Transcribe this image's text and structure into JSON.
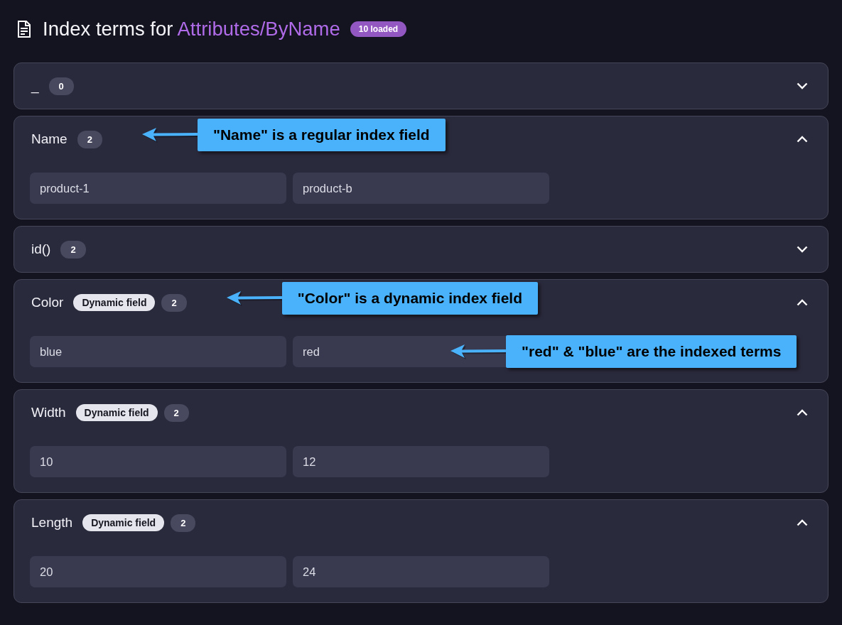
{
  "header": {
    "title_prefix": "Index terms for",
    "index_name": "Attributes/ByName",
    "loaded_badge": "10 loaded"
  },
  "fields": [
    {
      "name": "_",
      "count": "0",
      "expanded": false
    },
    {
      "name": "Name",
      "count": "2",
      "header_callout": "\"Name\" is a regular index field",
      "expanded": true,
      "terms": [
        "product-1",
        "product-b"
      ]
    },
    {
      "name": "id()",
      "count": "2",
      "expanded": false
    },
    {
      "name": "Color",
      "tag": "Dynamic field",
      "count": "2",
      "header_callout": "\"Color\" is a dynamic index field",
      "expanded": true,
      "terms": [
        "blue",
        "red"
      ],
      "terms_callout": "\"red\" & \"blue\" are the indexed terms"
    },
    {
      "name": "Width",
      "tag": "Dynamic field",
      "count": "2",
      "expanded": true,
      "terms": [
        "10",
        "12"
      ]
    },
    {
      "name": "Length",
      "tag": "Dynamic field",
      "count": "2",
      "expanded": true,
      "terms": [
        "20",
        "24"
      ]
    }
  ]
}
